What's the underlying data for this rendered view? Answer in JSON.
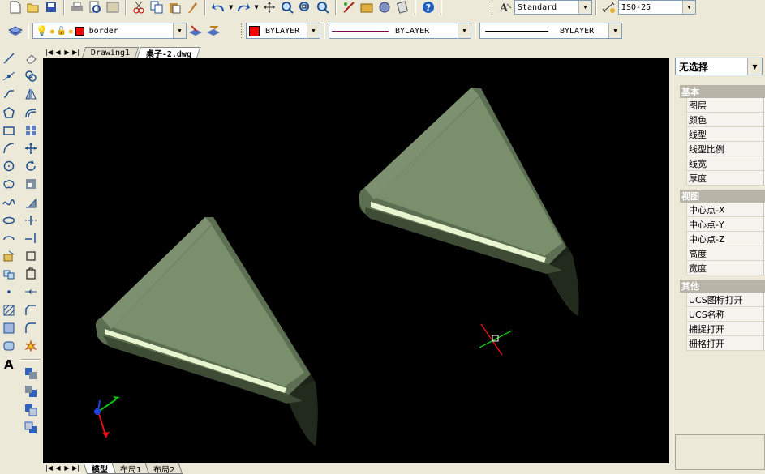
{
  "toolbar1": {
    "text_style": "Standard",
    "dim_style": "ISO-25"
  },
  "toolbar2": {
    "layer": "border",
    "color": "BYLAYER",
    "linetype": "BYLAYER",
    "lineweight": "BYLAYER"
  },
  "doc_tabs": [
    {
      "label": "Drawing1",
      "active": false
    },
    {
      "label": "桌子-2.dwg",
      "active": true
    }
  ],
  "layout_tabs": [
    {
      "label": "模型",
      "active": true
    },
    {
      "label": "布局1",
      "active": false
    },
    {
      "label": "布局2",
      "active": false
    }
  ],
  "properties": {
    "selection": "无选择",
    "categories": [
      {
        "title": "基本",
        "rows": [
          "图层",
          "颜色",
          "线型",
          "线型比例",
          "线宽",
          "厚度"
        ]
      },
      {
        "title": "视图",
        "rows": [
          "中心点-X",
          "中心点-Y",
          "中心点-Z",
          "高度",
          "宽度"
        ]
      },
      {
        "title": "其他",
        "rows": [
          "UCS图标打开",
          "UCS名称",
          "捕捉打开",
          "栅格打开"
        ]
      }
    ]
  },
  "colors": {
    "canvas": "#000000",
    "solid_face": "#7a8f6c",
    "solid_dark": "#4a5a40",
    "highlight": "#e8f5d0",
    "ucs_x": "#e01010",
    "ucs_y": "#10c010",
    "ucs_z": "#2040e0"
  }
}
